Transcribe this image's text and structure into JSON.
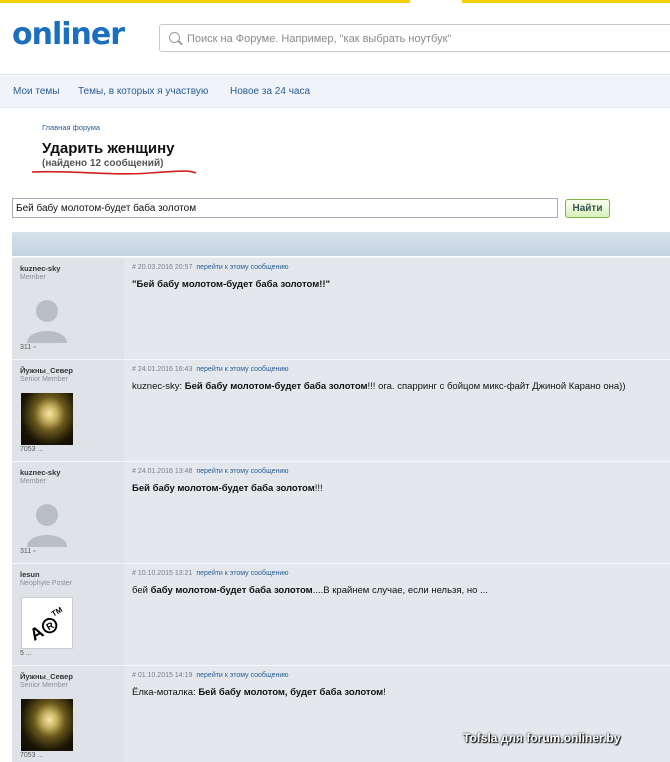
{
  "header": {
    "logo": "onliner",
    "search_placeholder": "Поиск на Форуме. Например, \"как выбрать ноутбук\""
  },
  "subnav": [
    "Мои темы",
    "Темы, в которых я участвую",
    "Новое за 24 часа"
  ],
  "breadcrumb": "Главная форума",
  "page": {
    "title": "Ударить женщину",
    "subtitle": "(найдено 12 сообщений)"
  },
  "search": {
    "query": "Бей бабу молотом-будет баба золотом",
    "button": "Найти"
  },
  "posts": [
    {
      "user": "kuznec-sky",
      "rank": "Member",
      "count": "311",
      "date": "# 20.03.2016 20:57",
      "link": "перейти к этому сообщению",
      "prefix": "",
      "bold": "\"Бей бабу молотом-будет баба золотом!!\"",
      "suffix": "",
      "avatar": "ghost"
    },
    {
      "user": "Йужны_Север",
      "rank": "Senior Member",
      "count": "7053",
      "date": "# 24.01.2016 16:43",
      "link": "перейти к этому сообщению",
      "prefix": "kuznec-sky: ",
      "bold": "Бей бабу молотом-будет баба золотом",
      "suffix": "!!! ога. спарринг с бойцом микс-файт Джиной Карано она))",
      "avatar": "dark"
    },
    {
      "user": "kuznec-sky",
      "rank": "Member",
      "count": "311",
      "date": "# 24.01.2016 13:48",
      "link": "перейти к этому сообщению",
      "prefix": "",
      "bold": "Бей бабу молотом-будет баба золотом",
      "suffix": "!!!",
      "avatar": "ghost"
    },
    {
      "user": "lesun",
      "rank": "Neophyte Poster",
      "count": "5",
      "date": "# 10.10.2015 13:21",
      "link": "перейти к этому сообщению",
      "prefix": "бей ",
      "bold": "бабу молотом-будет баба золотом",
      "suffix": "....В крайнем случае, если нельзя, но ...",
      "avatar": "artm"
    },
    {
      "user": "Йужны_Север",
      "rank": "Senior Member",
      "count": "7053",
      "date": "# 01.10.2015 14:19",
      "link": "перейти к этому сообщению",
      "prefix": "Ёлка-моталка: ",
      "bold": "Бей бабу молотом, будет баба золотом",
      "suffix": "!",
      "avatar": "dark"
    }
  ],
  "watermark": "Tofsla для forum.onliner.by"
}
